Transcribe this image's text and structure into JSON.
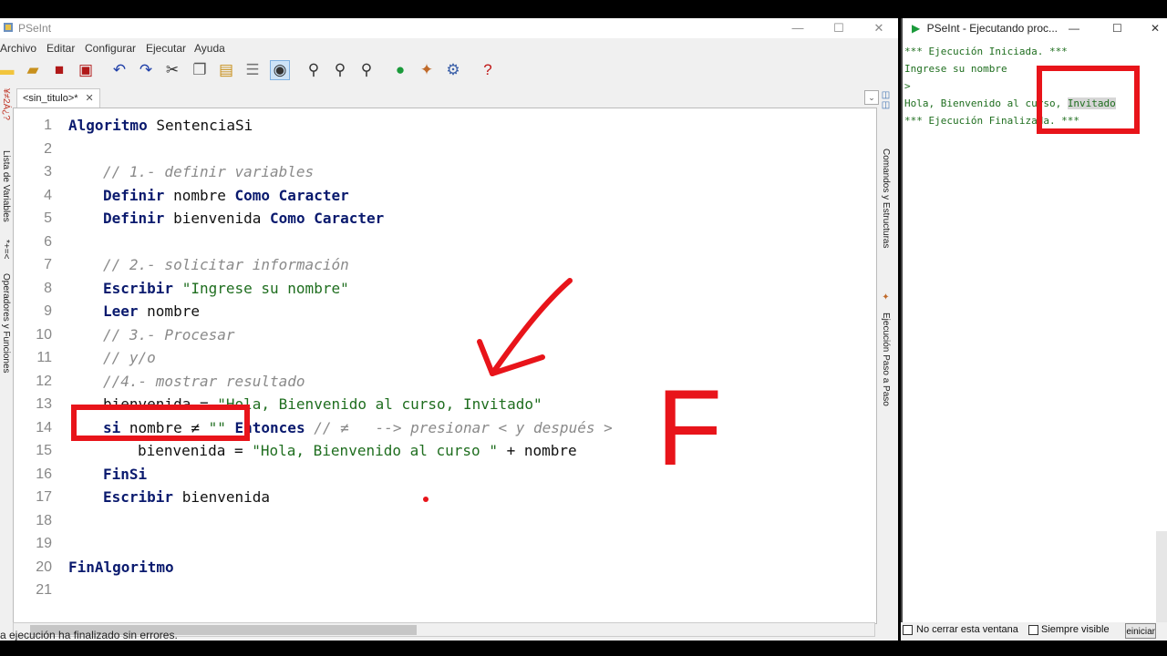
{
  "main_window": {
    "title": "PSeInt",
    "menu": [
      "Archivo",
      "Editar",
      "Configurar",
      "Ejecutar",
      "Ayuda"
    ],
    "tab_label": "<sin_titulo>*",
    "tab_close": "✕",
    "left_panels": [
      "Lista de Variables",
      "Operadores y Funciones"
    ],
    "right_panels": [
      "Comandos y Estructuras",
      "Ejecución Paso a Paso"
    ],
    "status": "a ejecución ha finalizado sin errores."
  },
  "code_lines": [
    {
      "n": "1",
      "parts": [
        [
          "kw",
          "Algoritmo"
        ],
        [
          "",
          "SentenciaSi"
        ]
      ],
      "indent": 0
    },
    {
      "n": "2",
      "parts": [],
      "indent": 0
    },
    {
      "n": "3",
      "parts": [
        [
          "cm",
          "// 1.- definir variables"
        ]
      ],
      "indent": 1
    },
    {
      "n": "4",
      "parts": [
        [
          "kw",
          "Definir"
        ],
        [
          "",
          "nombre"
        ],
        [
          "kw",
          "Como Caracter"
        ]
      ],
      "indent": 1
    },
    {
      "n": "5",
      "parts": [
        [
          "kw",
          "Definir"
        ],
        [
          "",
          "bienvenida"
        ],
        [
          "kw",
          "Como Caracter"
        ]
      ],
      "indent": 1
    },
    {
      "n": "6",
      "parts": [],
      "indent": 0
    },
    {
      "n": "7",
      "parts": [
        [
          "cm",
          "// 2.- solicitar información"
        ]
      ],
      "indent": 1
    },
    {
      "n": "8",
      "parts": [
        [
          "kw",
          "Escribir"
        ],
        [
          "st",
          "\"Ingrese su nombre\""
        ]
      ],
      "indent": 1
    },
    {
      "n": "9",
      "parts": [
        [
          "kw",
          "Leer"
        ],
        [
          "",
          "nombre"
        ]
      ],
      "indent": 1
    },
    {
      "n": "10",
      "parts": [
        [
          "cm",
          "// 3.- Procesar"
        ]
      ],
      "indent": 1
    },
    {
      "n": "11",
      "parts": [
        [
          "cm",
          "// y/o"
        ]
      ],
      "indent": 1
    },
    {
      "n": "12",
      "parts": [
        [
          "cm",
          "//4.- mostrar resultado"
        ]
      ],
      "indent": 1
    },
    {
      "n": "13",
      "parts": [
        [
          "",
          "bienvenida ="
        ],
        [
          "st",
          "\"Hola, Bienvenido al curso, Invitado\""
        ]
      ],
      "indent": 1
    },
    {
      "n": "14",
      "parts": [
        [
          "kw",
          "si"
        ],
        [
          "",
          "nombre ≠"
        ],
        [
          "st",
          "\"\""
        ],
        [
          "kw",
          "Entonces"
        ],
        [
          "cm",
          "// ≠   --> presionar < y después >"
        ]
      ],
      "indent": 1
    },
    {
      "n": "15",
      "parts": [
        [
          "",
          "bienvenida ="
        ],
        [
          "st",
          "\"Hola, Bienvenido al curso \""
        ],
        [
          "",
          "+ nombre"
        ]
      ],
      "indent": 2
    },
    {
      "n": "16",
      "parts": [
        [
          "kw",
          "FinSi"
        ]
      ],
      "indent": 1
    },
    {
      "n": "17",
      "parts": [
        [
          "kw",
          "Escribir"
        ],
        [
          "",
          "bienvenida"
        ]
      ],
      "indent": 1
    },
    {
      "n": "18",
      "parts": [],
      "indent": 0
    },
    {
      "n": "19",
      "parts": [],
      "indent": 0
    },
    {
      "n": "20",
      "parts": [
        [
          "kw",
          "FinAlgoritmo"
        ]
      ],
      "indent": 0
    },
    {
      "n": "21",
      "parts": [],
      "indent": 0
    }
  ],
  "run_window": {
    "title": "PSeInt - Ejecutando proc...",
    "console": [
      "*** Ejecución Iniciada. ***",
      "Ingrese su nombre",
      ">",
      "Hola, Bienvenido al curso, Invitado",
      "*** Ejecución Finalizada. ***"
    ],
    "no_cerrar": "No cerrar esta ventana",
    "siempre_visible": "Siempre visible",
    "reiniciar": "Reiniciar"
  },
  "annotation": {
    "letter": "F"
  },
  "colors": {
    "keyword": "#0a1a6e",
    "comment": "#8a8a8a",
    "string": "#1f6e1f",
    "annotation": "#e8141a"
  }
}
